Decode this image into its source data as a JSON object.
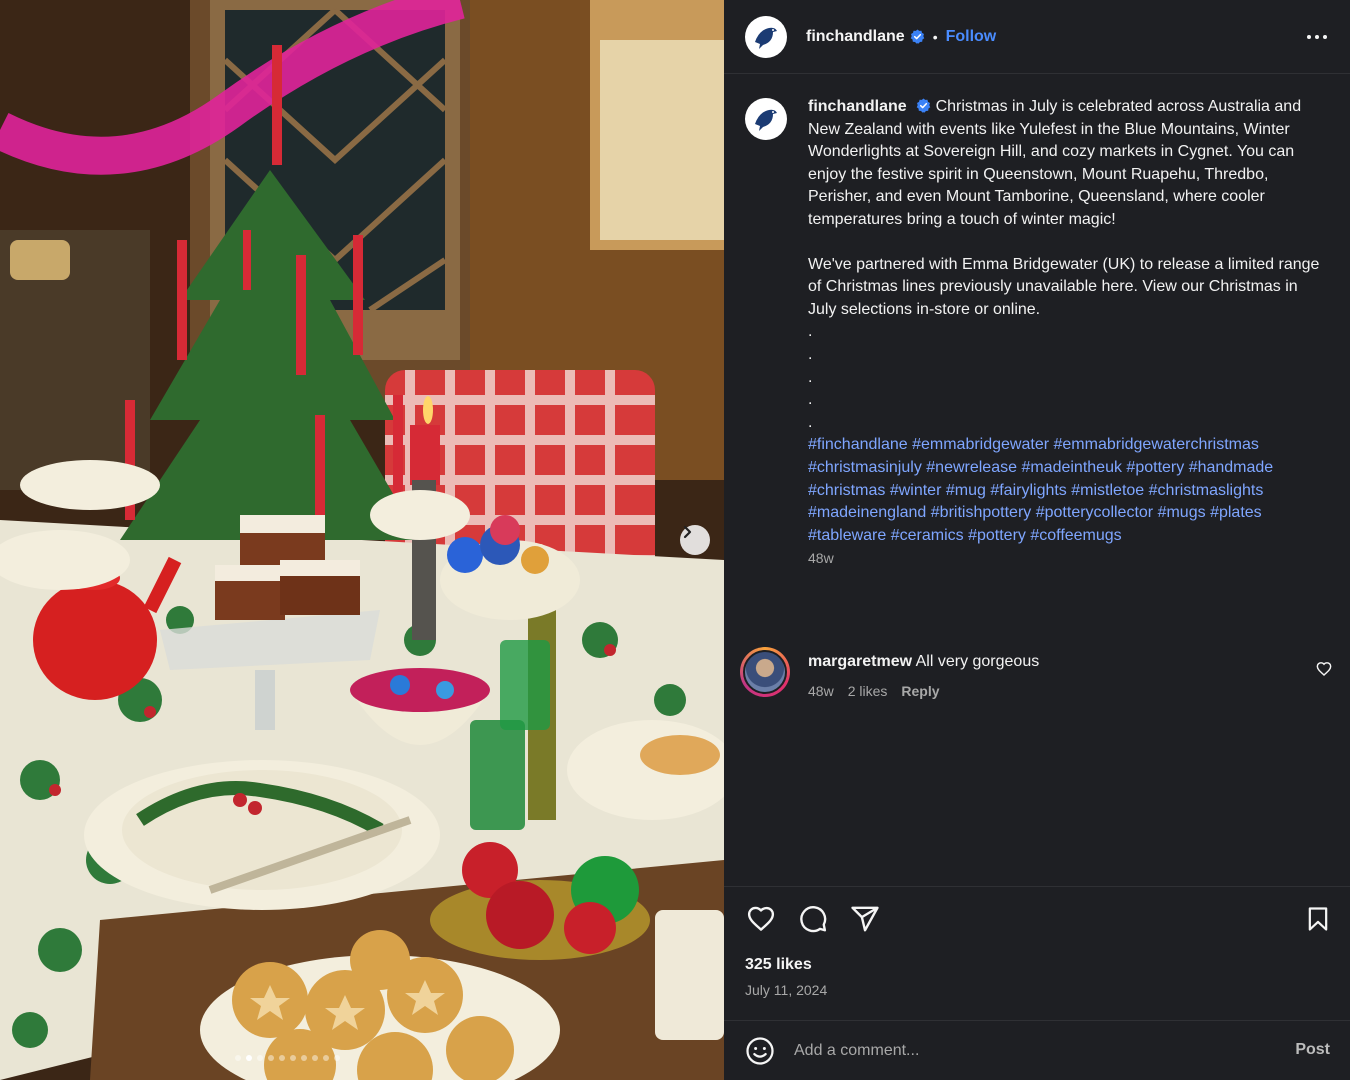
{
  "post": {
    "username": "finchandlane",
    "follow_label": "Follow",
    "separator": "•",
    "caption": {
      "paragraph1": "Christmas in July is celebrated across Australia and New Zealand with events like Yulefest in the Blue Mountains, Winter Wonderlights at Sovereign Hill, and cozy markets in Cygnet. You can enjoy the festive spirit in Queenstown, Mount Ruapehu, Thredbo, Perisher, and even Mount Tamborine, Queensland, where cooler temperatures bring a touch of winter magic!",
      "paragraph2": "We've partnered with Emma Bridgewater (UK) to release a limited range of Christmas lines previously unavailable here. View our Christmas in July selections in-store or online.",
      "dots": [
        ".",
        ".",
        ".",
        ".",
        "."
      ],
      "hashtags": [
        "#finchandlane",
        "#emmabridgewater",
        "#emmabridgewaterchristmas",
        "#christmasinjuly",
        "#newrelease",
        "#madeintheuk",
        "#pottery",
        "#handmade",
        "#christmas",
        "#winter",
        "#mug",
        "#fairylights",
        "#mistletoe",
        "#christmaslights",
        "#madeinengland",
        "#britishpottery",
        "#potterycollector",
        "#mugs",
        "#plates",
        "#tableware",
        "#ceramics",
        "#pottery",
        "#coffeemugs"
      ],
      "time_ago": "48w"
    },
    "comments": [
      {
        "username": "margaretmew",
        "text": "All very gorgeous",
        "time_ago": "48w",
        "likes": "2 likes",
        "reply_label": "Reply"
      }
    ],
    "likes_text": "325 likes",
    "date": "July 11, 2024",
    "comment_placeholder": "Add a comment...",
    "post_label": "Post"
  },
  "carousel": {
    "slide_count": 10,
    "active_index": 1
  },
  "colors": {
    "panel_bg": "#1e1f23",
    "link": "#4a8cff",
    "hashtag": "#7fa6ff",
    "secondary_text": "#a8a8a8"
  },
  "icons": [
    "bird-logo-icon",
    "verified-badge-icon",
    "more-options-icon",
    "carousel-next-icon",
    "heart-icon",
    "comment-icon",
    "share-icon",
    "bookmark-icon",
    "emoji-icon",
    "comment-heart-icon"
  ]
}
